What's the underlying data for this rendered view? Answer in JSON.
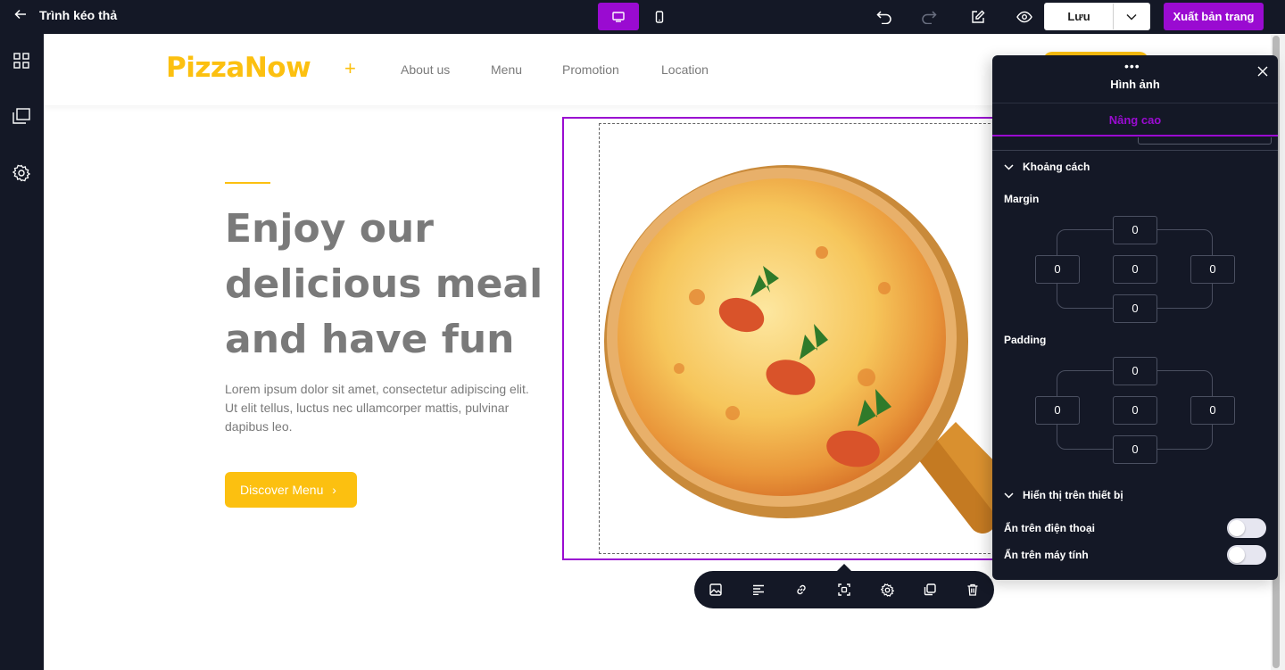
{
  "topbar": {
    "title": "Trình kéo thả",
    "save_label": "Lưu",
    "export_label": "Xuất bản trang"
  },
  "site": {
    "logo": "PizzaNow",
    "nav": [
      "About us",
      "Menu",
      "Promotion",
      "Location"
    ],
    "hero_title": "Enjoy our delicious meal and have fun",
    "hero_desc": "Lorem ipsum dolor sit amet, consectetur adipiscing elit. Ut elit tellus, luctus nec ullamcorper mattis, pulvinar dapibus leo.",
    "discover_label": "Discover Menu",
    "discover_arrow": "›"
  },
  "panel": {
    "title": "Hình ảnh",
    "tab": "Nâng cao",
    "spacing_section": "Khoảng cách",
    "margin_label": "Margin",
    "padding_label": "Padding",
    "margin": {
      "top": "0",
      "left": "0",
      "center": "0",
      "right": "0",
      "bottom": "0"
    },
    "padding": {
      "top": "0",
      "left": "0",
      "center": "0",
      "right": "0",
      "bottom": "0"
    },
    "device_section": "Hiển thị trên thiết bị",
    "hide_mobile_label": "Ẩn trên điện thoại",
    "hide_desktop_label": "Ẩn trên máy tính",
    "hide_mobile": false,
    "hide_desktop": false
  },
  "colors": {
    "accent_purple": "#9a0bd1",
    "brand_yellow": "#fcc010",
    "dark_bg": "#141826",
    "text_gray": "#7a7a7a"
  }
}
